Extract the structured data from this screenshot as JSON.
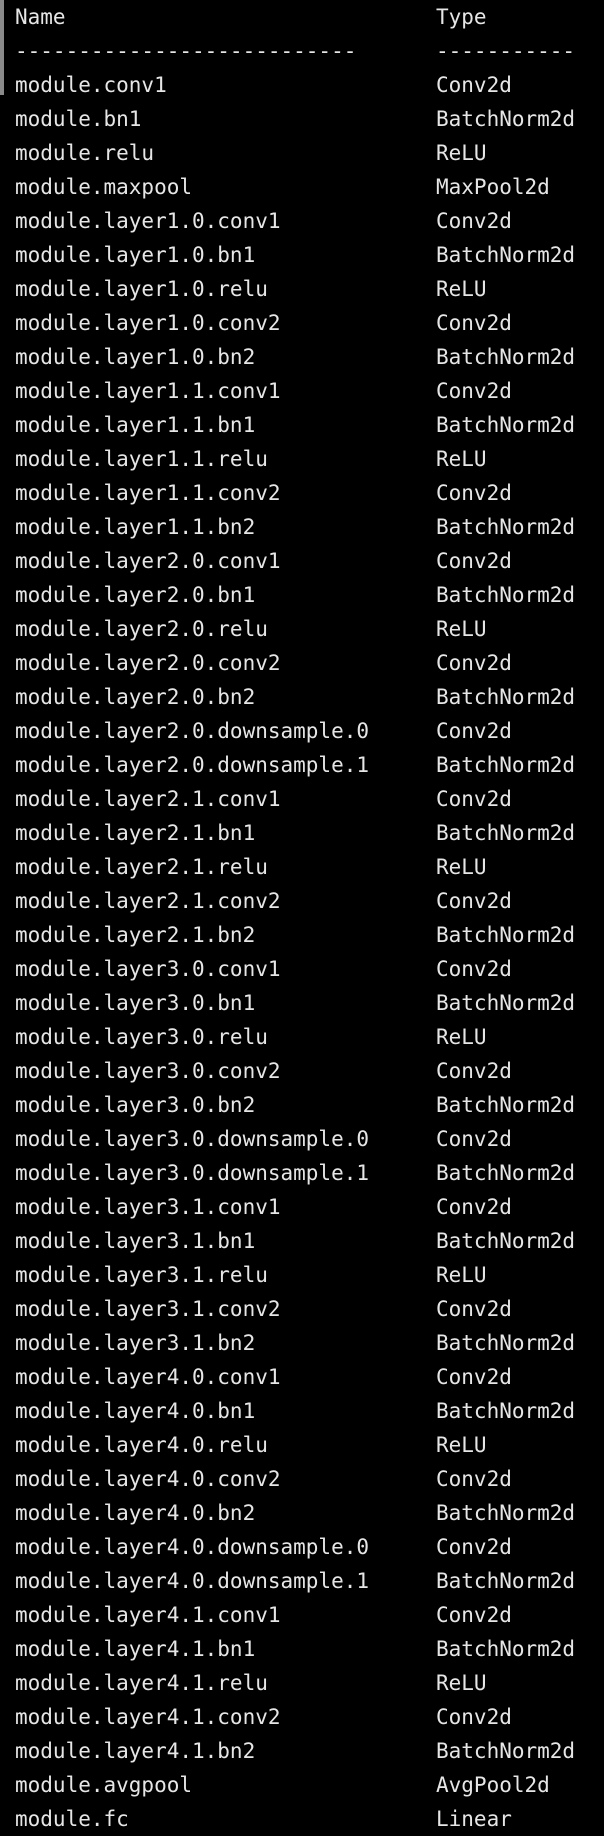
{
  "terminal": {
    "header": {
      "name": "Name",
      "type": "Type"
    },
    "rule": {
      "name": "---------------------------",
      "type": "-----------"
    },
    "rows": [
      {
        "name": "module.conv1",
        "type": "Conv2d"
      },
      {
        "name": "module.bn1",
        "type": "BatchNorm2d"
      },
      {
        "name": "module.relu",
        "type": "ReLU"
      },
      {
        "name": "module.maxpool",
        "type": "MaxPool2d"
      },
      {
        "name": "module.layer1.0.conv1",
        "type": "Conv2d"
      },
      {
        "name": "module.layer1.0.bn1",
        "type": "BatchNorm2d"
      },
      {
        "name": "module.layer1.0.relu",
        "type": "ReLU"
      },
      {
        "name": "module.layer1.0.conv2",
        "type": "Conv2d"
      },
      {
        "name": "module.layer1.0.bn2",
        "type": "BatchNorm2d"
      },
      {
        "name": "module.layer1.1.conv1",
        "type": "Conv2d"
      },
      {
        "name": "module.layer1.1.bn1",
        "type": "BatchNorm2d"
      },
      {
        "name": "module.layer1.1.relu",
        "type": "ReLU"
      },
      {
        "name": "module.layer1.1.conv2",
        "type": "Conv2d"
      },
      {
        "name": "module.layer1.1.bn2",
        "type": "BatchNorm2d"
      },
      {
        "name": "module.layer2.0.conv1",
        "type": "Conv2d"
      },
      {
        "name": "module.layer2.0.bn1",
        "type": "BatchNorm2d"
      },
      {
        "name": "module.layer2.0.relu",
        "type": "ReLU"
      },
      {
        "name": "module.layer2.0.conv2",
        "type": "Conv2d"
      },
      {
        "name": "module.layer2.0.bn2",
        "type": "BatchNorm2d"
      },
      {
        "name": "module.layer2.0.downsample.0",
        "type": "Conv2d"
      },
      {
        "name": "module.layer2.0.downsample.1",
        "type": "BatchNorm2d"
      },
      {
        "name": "module.layer2.1.conv1",
        "type": "Conv2d"
      },
      {
        "name": "module.layer2.1.bn1",
        "type": "BatchNorm2d"
      },
      {
        "name": "module.layer2.1.relu",
        "type": "ReLU"
      },
      {
        "name": "module.layer2.1.conv2",
        "type": "Conv2d"
      },
      {
        "name": "module.layer2.1.bn2",
        "type": "BatchNorm2d"
      },
      {
        "name": "module.layer3.0.conv1",
        "type": "Conv2d"
      },
      {
        "name": "module.layer3.0.bn1",
        "type": "BatchNorm2d"
      },
      {
        "name": "module.layer3.0.relu",
        "type": "ReLU"
      },
      {
        "name": "module.layer3.0.conv2",
        "type": "Conv2d"
      },
      {
        "name": "module.layer3.0.bn2",
        "type": "BatchNorm2d"
      },
      {
        "name": "module.layer3.0.downsample.0",
        "type": "Conv2d"
      },
      {
        "name": "module.layer3.0.downsample.1",
        "type": "BatchNorm2d"
      },
      {
        "name": "module.layer3.1.conv1",
        "type": "Conv2d"
      },
      {
        "name": "module.layer3.1.bn1",
        "type": "BatchNorm2d"
      },
      {
        "name": "module.layer3.1.relu",
        "type": "ReLU"
      },
      {
        "name": "module.layer3.1.conv2",
        "type": "Conv2d"
      },
      {
        "name": "module.layer3.1.bn2",
        "type": "BatchNorm2d"
      },
      {
        "name": "module.layer4.0.conv1",
        "type": "Conv2d"
      },
      {
        "name": "module.layer4.0.bn1",
        "type": "BatchNorm2d"
      },
      {
        "name": "module.layer4.0.relu",
        "type": "ReLU"
      },
      {
        "name": "module.layer4.0.conv2",
        "type": "Conv2d"
      },
      {
        "name": "module.layer4.0.bn2",
        "type": "BatchNorm2d"
      },
      {
        "name": "module.layer4.0.downsample.0",
        "type": "Conv2d"
      },
      {
        "name": "module.layer4.0.downsample.1",
        "type": "BatchNorm2d"
      },
      {
        "name": "module.layer4.1.conv1",
        "type": "Conv2d"
      },
      {
        "name": "module.layer4.1.bn1",
        "type": "BatchNorm2d"
      },
      {
        "name": "module.layer4.1.relu",
        "type": "ReLU"
      },
      {
        "name": "module.layer4.1.conv2",
        "type": "Conv2d"
      },
      {
        "name": "module.layer4.1.bn2",
        "type": "BatchNorm2d"
      },
      {
        "name": "module.avgpool",
        "type": "AvgPool2d"
      },
      {
        "name": "module.fc",
        "type": "Linear"
      }
    ]
  },
  "colors": {
    "background": "#000000",
    "text": "#e6e6e6",
    "scroll_edge": "#8a8a8a"
  }
}
